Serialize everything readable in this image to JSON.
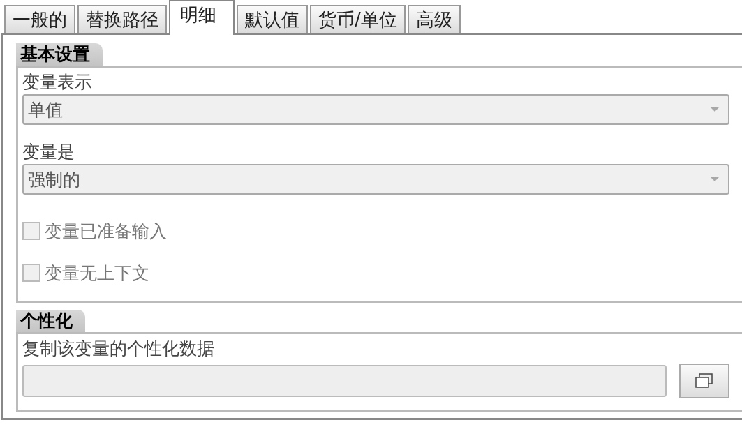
{
  "tabs": [
    {
      "label": "一般的",
      "selected": false
    },
    {
      "label": "替换路径",
      "selected": false
    },
    {
      "label": "明细",
      "selected": true
    },
    {
      "label": "默认值",
      "selected": false
    },
    {
      "label": "货币/单位",
      "selected": false
    },
    {
      "label": "高级",
      "selected": false
    }
  ],
  "sections": [
    {
      "title": "基本设置",
      "items": [
        {
          "kind": "dropdown",
          "label": "变量表示",
          "value": "单值"
        },
        {
          "kind": "dropdown",
          "label": "变量是",
          "value": "强制的"
        },
        {
          "kind": "checkbox",
          "label": "变量已准备输入",
          "checked": false,
          "disabled": true
        },
        {
          "kind": "checkbox",
          "label": "变量无上下文",
          "checked": false,
          "disabled": true
        }
      ]
    },
    {
      "title": "个性化",
      "items": [
        {
          "kind": "textbutton",
          "label": "复制该变量的个性化数据"
        }
      ]
    }
  ]
}
